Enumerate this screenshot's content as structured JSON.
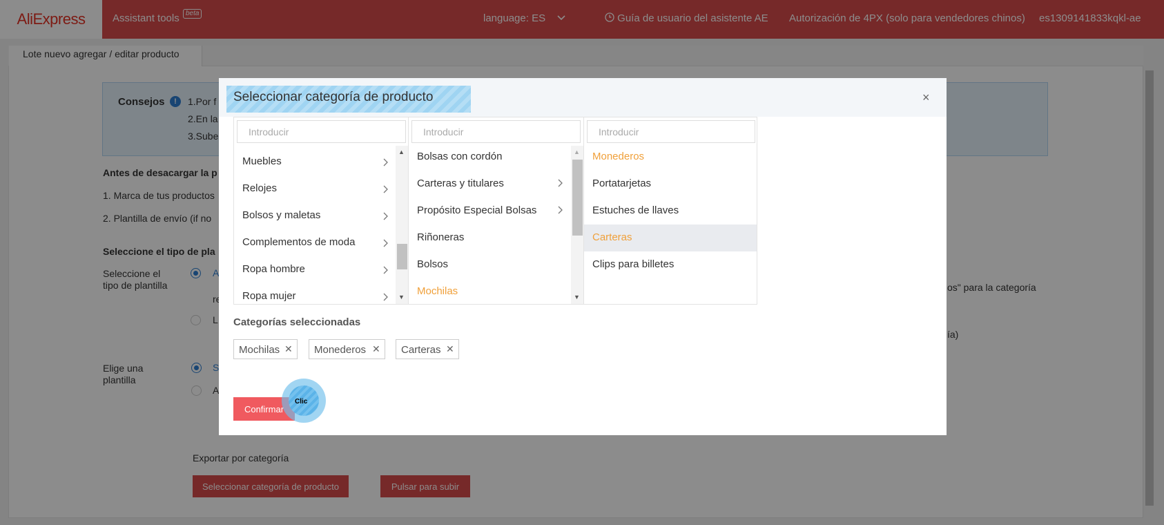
{
  "header": {
    "logo": "AliExpress",
    "tools": "Assistant tools",
    "beta": "beta",
    "language": "language: ES",
    "guide": "Guía de usuario del asistente AE",
    "auth": "Autorización de 4PX (solo para vendedores chinos)",
    "user": "es1309141833kqkl-ae"
  },
  "page": {
    "tab": "Lote nuevo agregar / editar producto",
    "tips_title": "Consejos",
    "tips_lines": [
      "1.Por f",
      "2.En la",
      "3.Sube"
    ],
    "before_heading": "Antes de desacargar la p",
    "before_items": [
      "1. Marca de tus productos",
      "2. Plantilla de envío (if no"
    ],
    "select_type_heading": "Seleccione el tipo de pla",
    "select_type_label": "Seleccione el tipo de plantilla",
    "select_type_label_line2": "tipo de plantilla",
    "select_type_label_line1": "Seleccione el",
    "radio_option_a": "A",
    "radio_option_a_cont": "re",
    "radio_option_l": "L",
    "right_text_1": "os\" para la categoría",
    "right_text_2": "ía)",
    "choose_label_line1": "Elige una",
    "choose_label_line2": "plantilla",
    "choose_opt_s": "S",
    "choose_opt_a": "A",
    "export_label": "Exportar por categoría",
    "btn_select_category": "Seleccionar categoría de producto",
    "btn_upload": "Pulsar para subir"
  },
  "modal": {
    "title": "Seleccionar categoría de producto",
    "close": "×",
    "search_placeholder": "Introducir",
    "col1": [
      "Muebles",
      "Relojes",
      "Bolsos y maletas",
      "Complementos de moda",
      "Ropa hombre",
      "Ropa mujer"
    ],
    "col2": [
      "Bolsas con cordón",
      "Carteras y titulares",
      "Propósito Especial Bolsas",
      "Riñoneras",
      "Bolsos",
      "Mochilas"
    ],
    "col3": [
      "Monederos",
      "Portatarjetas",
      "Estuches de llaves",
      "Carteras",
      "Clips para billetes"
    ],
    "selected_heading": "Categorías seleccionadas",
    "selected_tags": [
      "Mochilas",
      "Monederos",
      "Carteras"
    ],
    "confirm": "Confirmar",
    "click_label": "Clic"
  },
  "colors": {
    "header_red": "#d84b4b",
    "selected_orange": "#f0a03a",
    "confirm_red": "#f05a5f"
  }
}
